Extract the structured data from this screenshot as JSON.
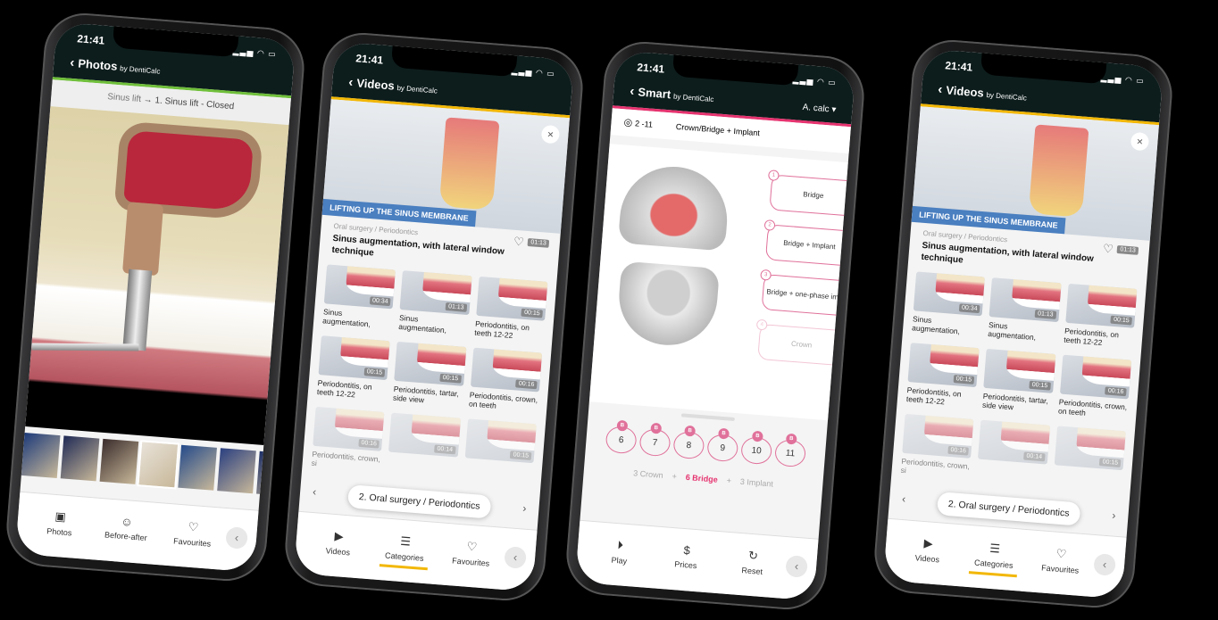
{
  "colors": {
    "header": "#0d1d1c",
    "photos_accent": "#6fbf3a",
    "videos_accent": "#f2b705",
    "smart_accent": "#e6336f",
    "tooth_pink": "#e0719a",
    "banner_blue": "#4a7fc0"
  },
  "status": {
    "time": "21:41",
    "icons": "signal-icon wifi-icon battery-icon"
  },
  "brand": "by DentiCalc",
  "photos": {
    "title": "Photos",
    "breadcrumb_parent": "Sinus lift",
    "breadcrumb_arrow": "→",
    "breadcrumb_current": "1. Sinus lift - Closed",
    "nav": [
      {
        "label": "Photos",
        "icon": "image-icon"
      },
      {
        "label": "Before-after",
        "icon": "smiley-icon"
      },
      {
        "label": "Favourites",
        "icon": "heart-icon"
      }
    ]
  },
  "videos": {
    "title": "Videos",
    "banner": "LIFTING UP THE SINUS MEMBRANE",
    "category": "Oral surgery / Periodontics",
    "video_title": "Sinus augmentation, with lateral window technique",
    "duration": "01:13",
    "items": [
      {
        "caption": "Sinus augmentation,",
        "duration": "00:34"
      },
      {
        "caption": "Sinus augmentation,",
        "duration": "01:13"
      },
      {
        "caption": "Periodontitis, on teeth 12-22",
        "duration": "00:15"
      },
      {
        "caption": "Periodontitis, on teeth 12-22",
        "duration": "00:15"
      },
      {
        "caption": "Periodontitis, tartar, side view",
        "duration": "00:15"
      },
      {
        "caption": "Periodontitis, crown, on teeth",
        "duration": "00:16"
      },
      {
        "caption": "Periodontitis, crown, si",
        "duration": "00:16"
      },
      {
        "caption": "",
        "duration": "00:14"
      },
      {
        "caption": "",
        "duration": "00:15"
      }
    ],
    "category_pill": "2. Oral surgery / Periodontics",
    "nav": [
      {
        "label": "Videos",
        "icon": "play-icon"
      },
      {
        "label": "Categories",
        "icon": "list-icon",
        "active": true
      },
      {
        "label": "Favourites",
        "icon": "heart-icon"
      }
    ]
  },
  "smart": {
    "title": "Smart",
    "calc": "A. calc",
    "range": "2 -11",
    "plan": "Crown/Bridge + Implant",
    "options": [
      {
        "n": "1",
        "label": "Bridge"
      },
      {
        "n": "2",
        "label": "Bridge + Implant"
      },
      {
        "n": "3",
        "label": "Bridge + one-phase imp."
      },
      {
        "n": "4",
        "label": "Crown"
      }
    ],
    "teeth": [
      "6",
      "7",
      "8",
      "9",
      "10",
      "11"
    ],
    "tooth_badge": "B",
    "summary": [
      {
        "text": "3 Crown",
        "hl": false
      },
      {
        "text": "+",
        "hl": false
      },
      {
        "text": "6 Bridge",
        "hl": true
      },
      {
        "text": "+",
        "hl": false
      },
      {
        "text": "3 Implant",
        "hl": false
      }
    ],
    "nav": [
      {
        "label": "Play",
        "icon": "play-circle-icon"
      },
      {
        "label": "Prices",
        "icon": "dollar-icon"
      },
      {
        "label": "Reset",
        "icon": "reset-icon"
      }
    ]
  }
}
